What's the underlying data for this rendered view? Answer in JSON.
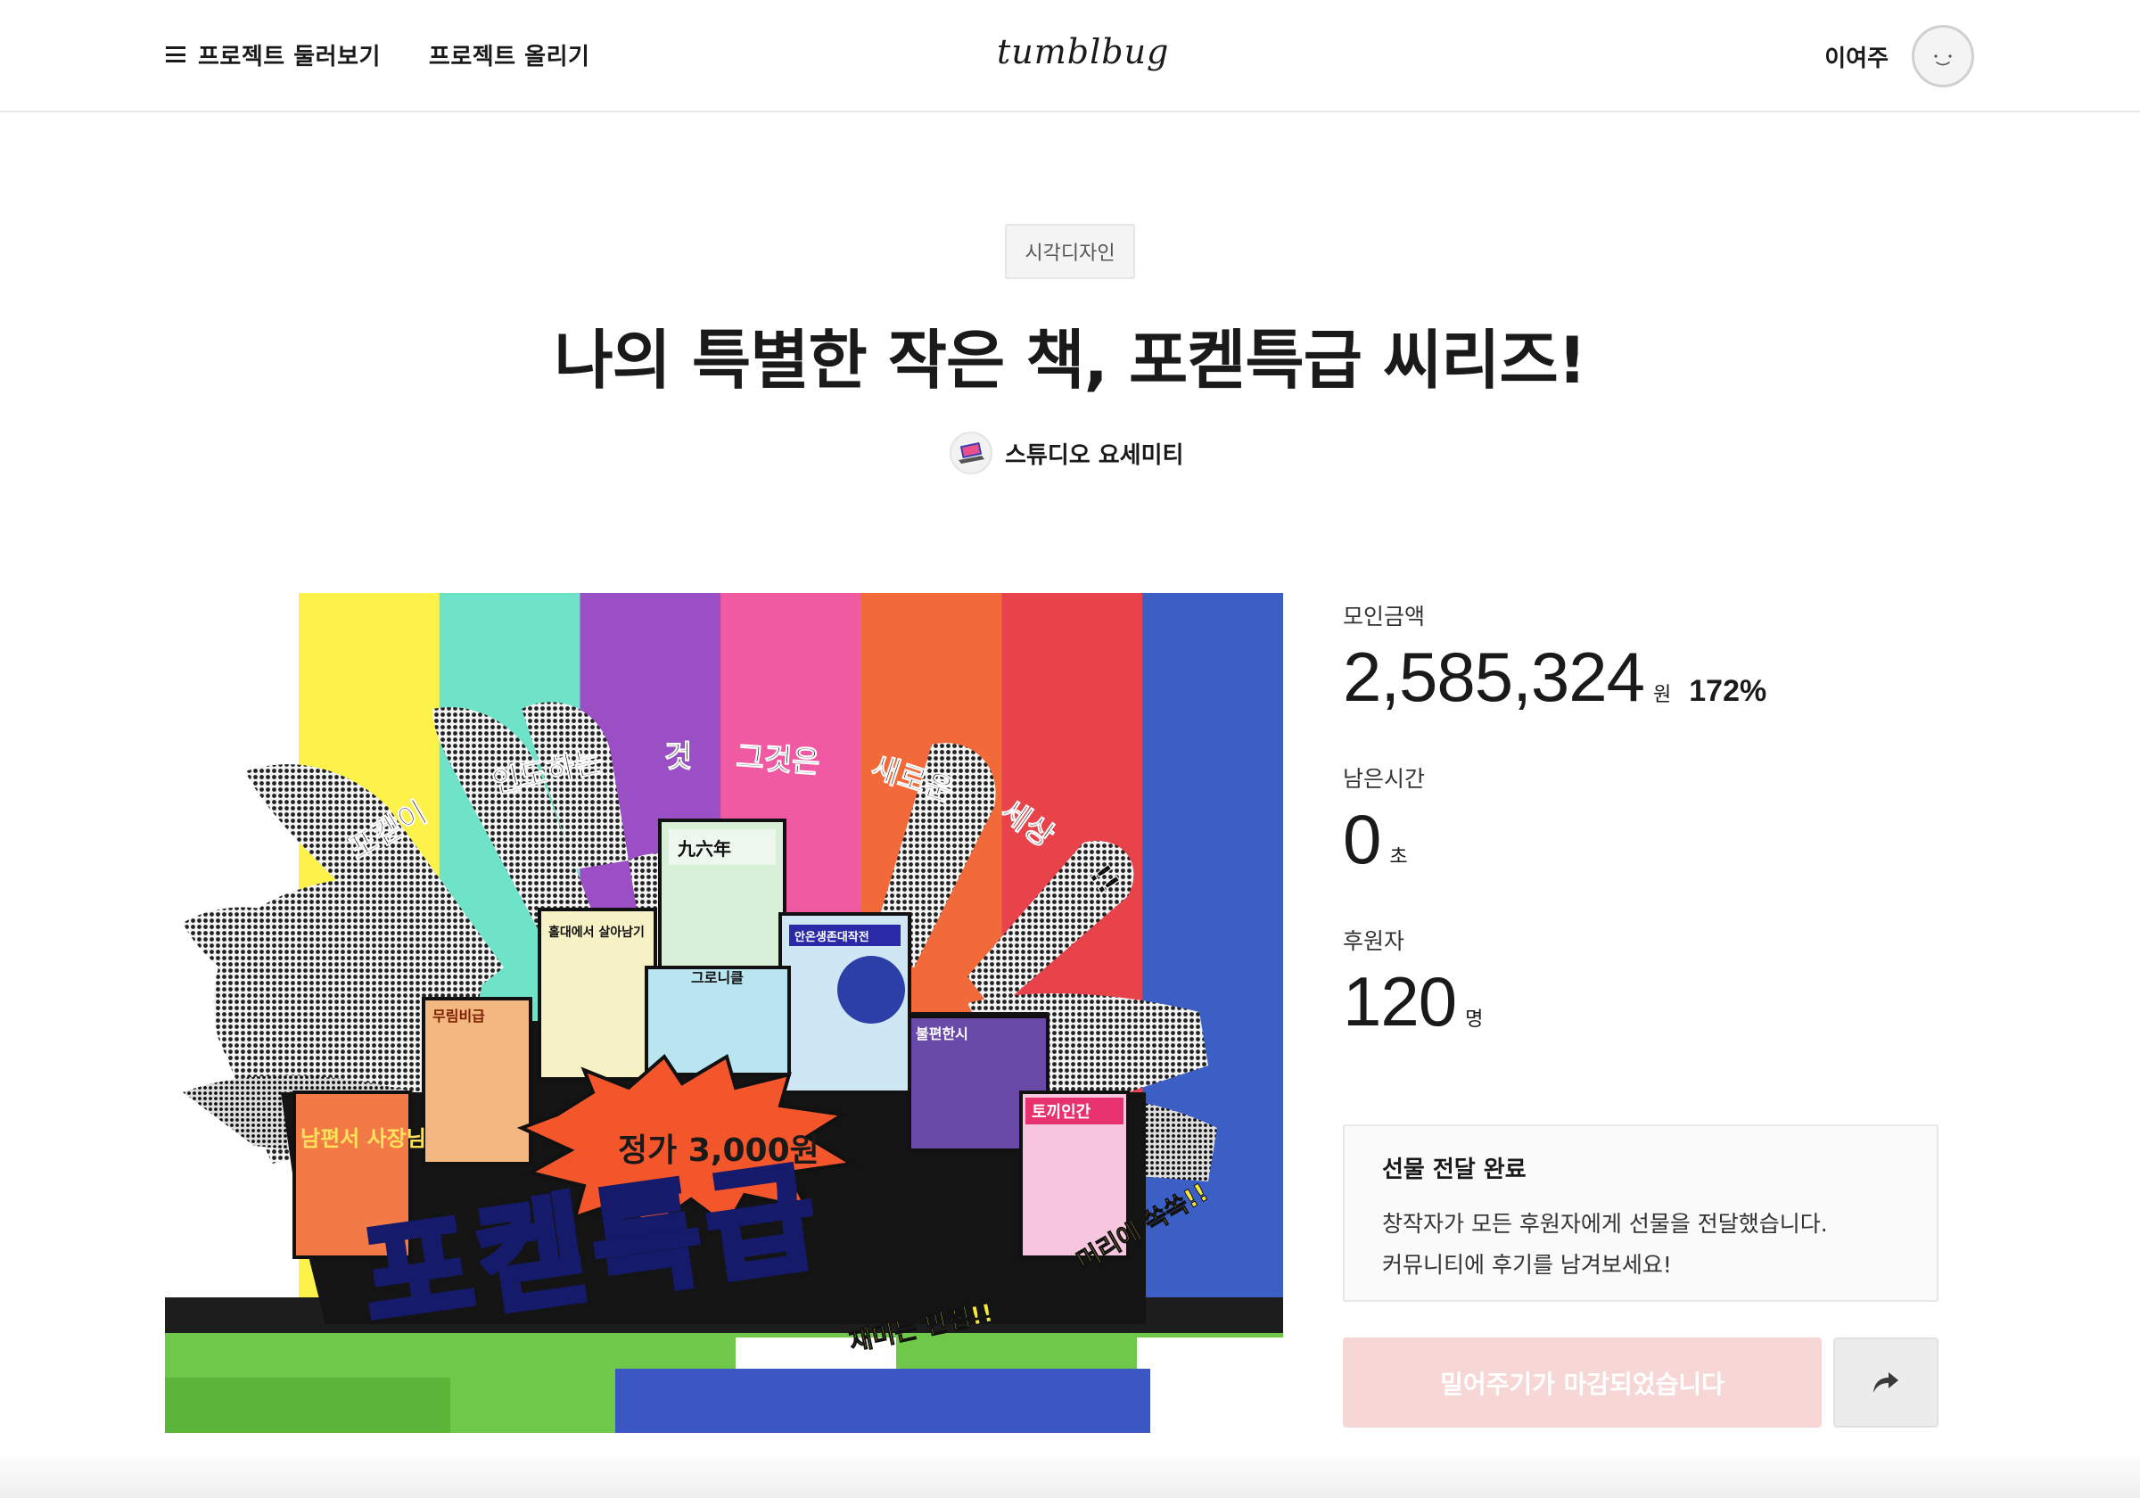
{
  "header": {
    "nav_browse": "프로젝트 둘러보기",
    "nav_upload": "프로젝트 올리기",
    "logo": "tumblbug",
    "user_name": "이여주"
  },
  "project": {
    "category": "시각디자인",
    "title": "나의 특별한 작은 책, 포켇특급 씨리즈!",
    "creator": "스튜디오 요세미티",
    "image": {
      "poster_text_arc": [
        "포켇이",
        "인도하는",
        "것",
        "그것은",
        "새로운",
        "세상",
        "!!"
      ],
      "price_tag": "정가 3,000원",
      "big_title": "포켇특급",
      "slogan_left": "재미는 만점!!",
      "slogan_right": "머리에 쏙쏙!!",
      "book_labels": [
        "九六年",
        "홀대에서 살아남기",
        "그로니클",
        "안온생존대작전",
        "불편한시",
        "무림비급",
        "남편서 사장님",
        "토끼인간"
      ]
    }
  },
  "stats": {
    "raised_label": "모인금액",
    "raised_value": "2,585,324",
    "raised_unit": "원",
    "percent": "172%",
    "remaining_label": "남은시간",
    "remaining_value": "0",
    "remaining_unit": "초",
    "backers_label": "후원자",
    "backers_value": "120",
    "backers_unit": "명"
  },
  "notice": {
    "title": "선물 전달 완료",
    "line1": "창작자가 모든 후원자에게 선물을 전달했습니다.",
    "line2": "커뮤니티에 후기를 남겨보세요!"
  },
  "actions": {
    "closed_button": "밀어주기가 마감되었습니다"
  },
  "colors": {
    "bar_colors": [
      "#fdf24a",
      "#6fe3c8",
      "#9a4fc4",
      "#f05aa3",
      "#f26a3a",
      "#e8424a",
      "#3b5fc4"
    ],
    "button_disabled_bg": "#f7d6d6"
  },
  "icons": {
    "menu": "hamburger-icon",
    "share": "share-arrow-icon",
    "avatar": "smiley-avatar"
  }
}
